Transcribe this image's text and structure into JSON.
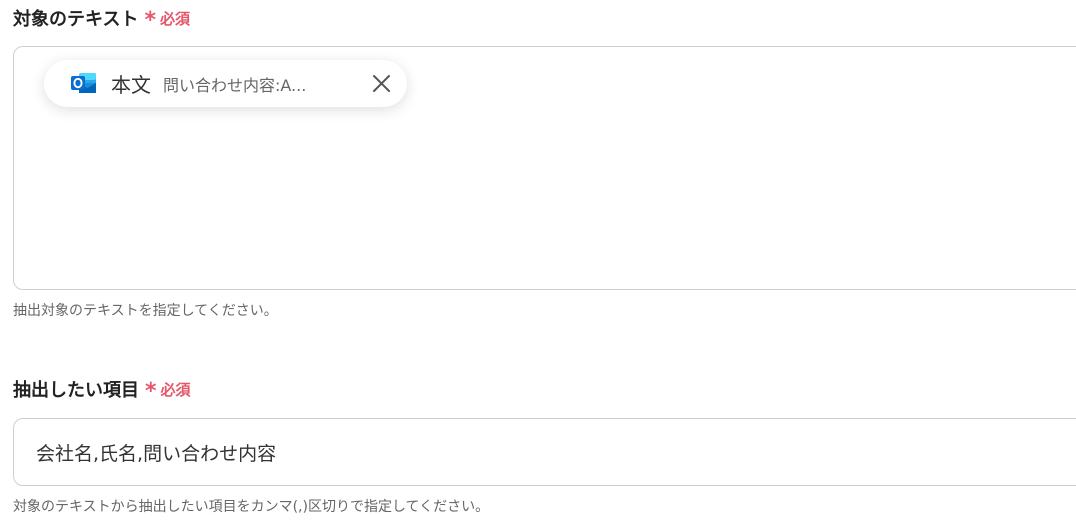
{
  "field1": {
    "label": "対象のテキスト",
    "required_mark": "*",
    "required_text": "必須",
    "chip": {
      "icon": "outlook-icon",
      "title": "本文",
      "value": "問い合わせ内容:A..."
    },
    "help": "抽出対象のテキストを指定してください。"
  },
  "field2": {
    "label": "抽出したい項目",
    "required_mark": "*",
    "required_text": "必須",
    "value": "会社名,氏名,問い合わせ内容",
    "help": "対象のテキストから抽出したい項目をカンマ(,)区切りで指定してください。"
  },
  "colors": {
    "required": "#e5566a",
    "outlook_blue": "#0a6ed1"
  }
}
